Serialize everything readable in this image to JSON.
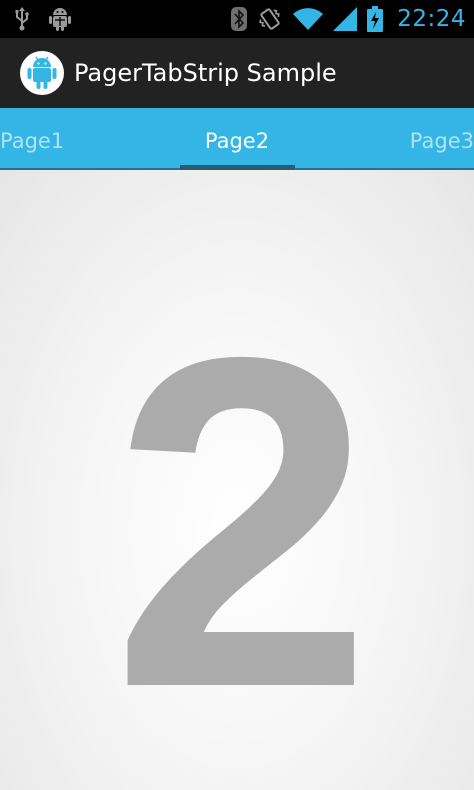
{
  "status_bar": {
    "time": "22:24",
    "icons": [
      "usb-icon",
      "android-debug-icon",
      "bluetooth-icon",
      "vibrate-icon",
      "wifi-icon",
      "signal-icon",
      "battery-charging-icon"
    ],
    "accent_color": "#33b5e5"
  },
  "action_bar": {
    "title": "PagerTabStrip Sample",
    "icon": "android-launcher-icon"
  },
  "tab_strip": {
    "background_color": "#33b5e5",
    "tabs": [
      {
        "label": "Page1",
        "state": "previous"
      },
      {
        "label": "Page2",
        "state": "current"
      },
      {
        "label": "Page3",
        "state": "next"
      }
    ]
  },
  "page": {
    "content": "2"
  }
}
